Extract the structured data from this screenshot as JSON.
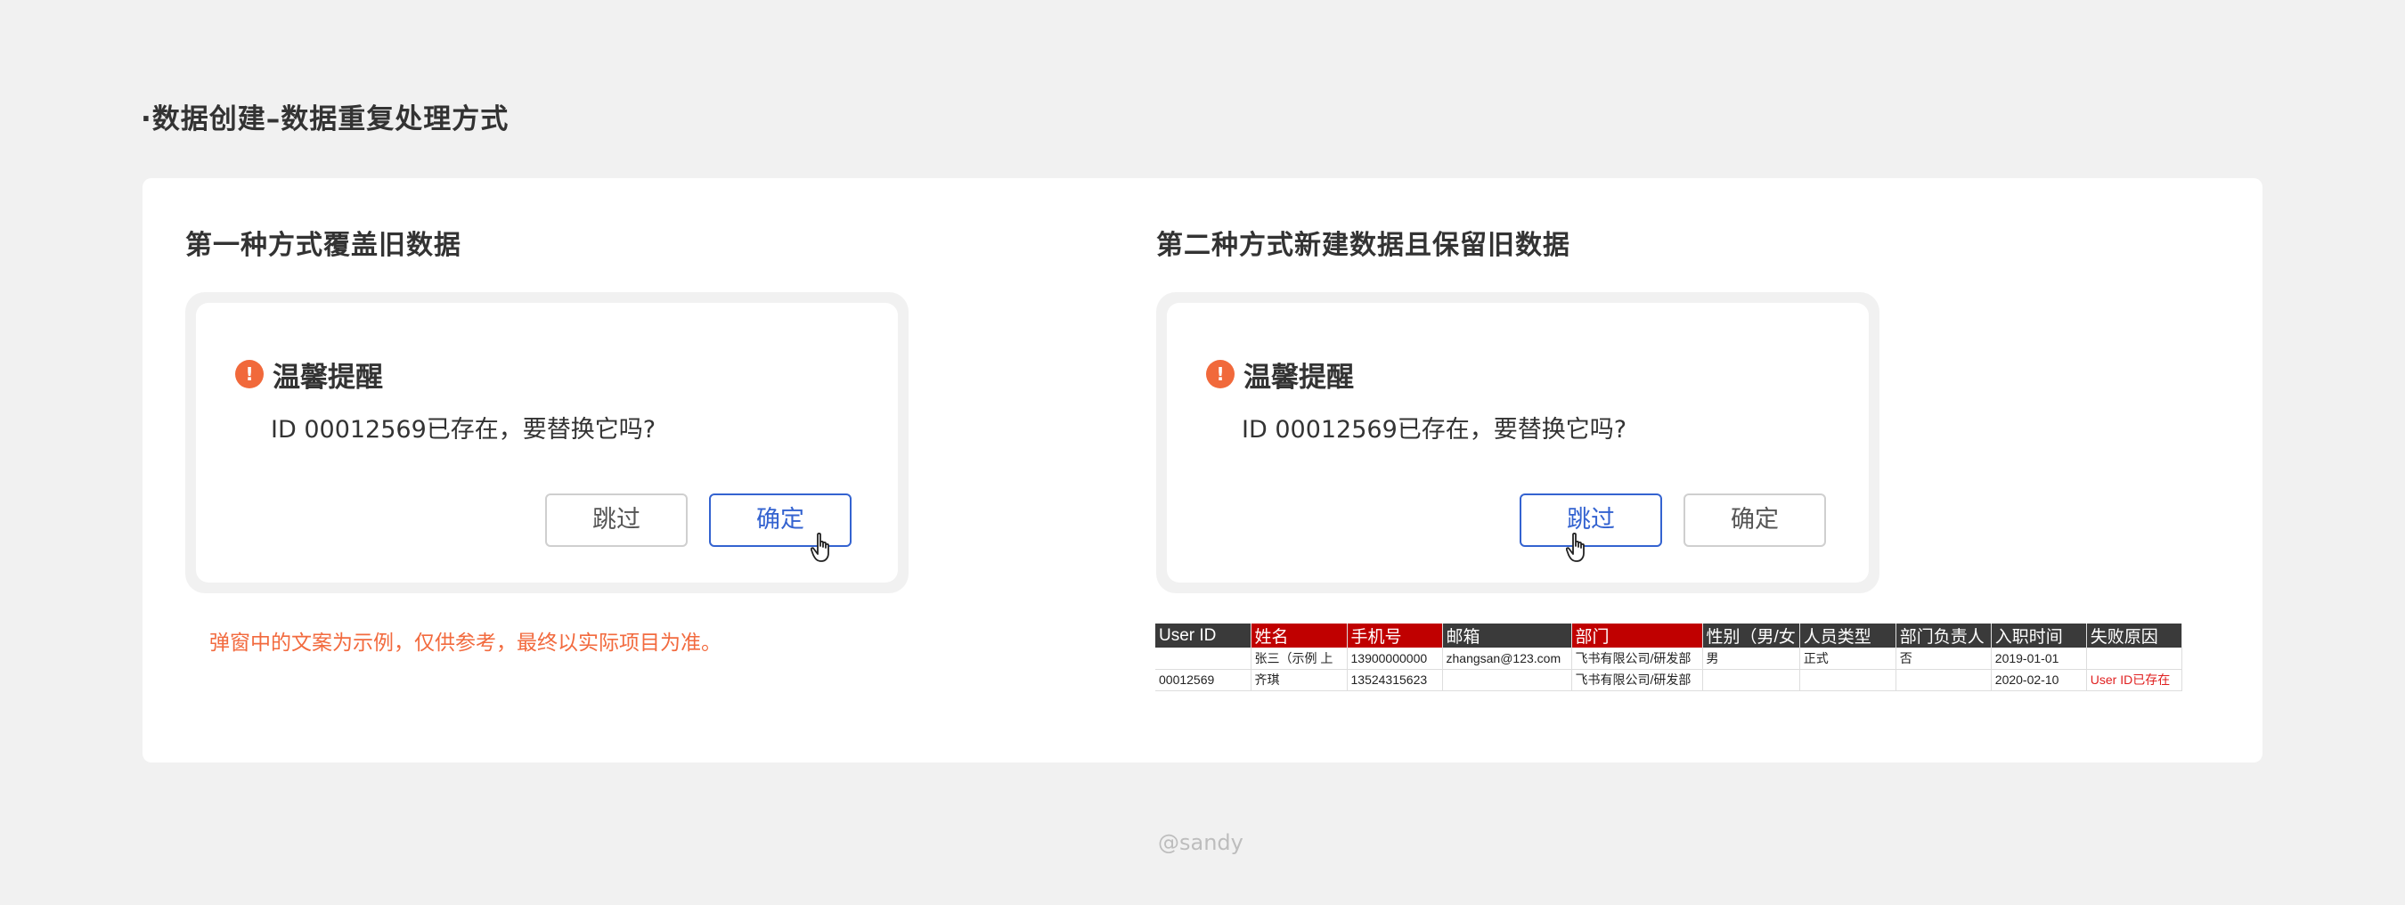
{
  "page_heading": "·数据创建–数据重复处理方式",
  "left": {
    "title": "第一种方式覆盖旧数据",
    "dialog": {
      "icon": "!",
      "title": "温馨提醒",
      "body": "ID 00012569已存在，要替换它吗?",
      "skip_label": "跳过",
      "confirm_label": "确定"
    },
    "note": "弹窗中的文案为示例，仅供参考，最终以实际项目为准。"
  },
  "right": {
    "title": "第二种方式新建数据且保留旧数据",
    "dialog": {
      "icon": "!",
      "title": "温馨提醒",
      "body": "ID 00012569已存在，要替换它吗?",
      "skip_label": "跳过",
      "confirm_label": "确定"
    },
    "sheet": {
      "headers": [
        "User ID",
        "姓名",
        "手机号",
        "邮箱",
        "部门",
        "性别（男/女",
        "人员类型",
        "部门负责人",
        "入职时间",
        "失败原因"
      ],
      "rows": [
        [
          "",
          "张三（示例 上",
          "13900000000",
          "zhangsan@123.com",
          "飞书有限公司/研发部",
          "男",
          "正式",
          "否",
          "2019-01-01",
          ""
        ],
        [
          "00012569",
          "齐琪",
          "13524315623",
          "",
          "飞书有限公司/研发部",
          "",
          "",
          "",
          "2020-02-10",
          "User ID已存在"
        ]
      ]
    }
  },
  "credit": "@sandy",
  "colors": {
    "accent": "#3463d0",
    "warning": "#f1693b",
    "required_header": "#c00000",
    "error_text": "#e02020"
  },
  "icons": {
    "warning": "exclamation-circle-icon",
    "cursor": "hand-pointer-icon"
  }
}
